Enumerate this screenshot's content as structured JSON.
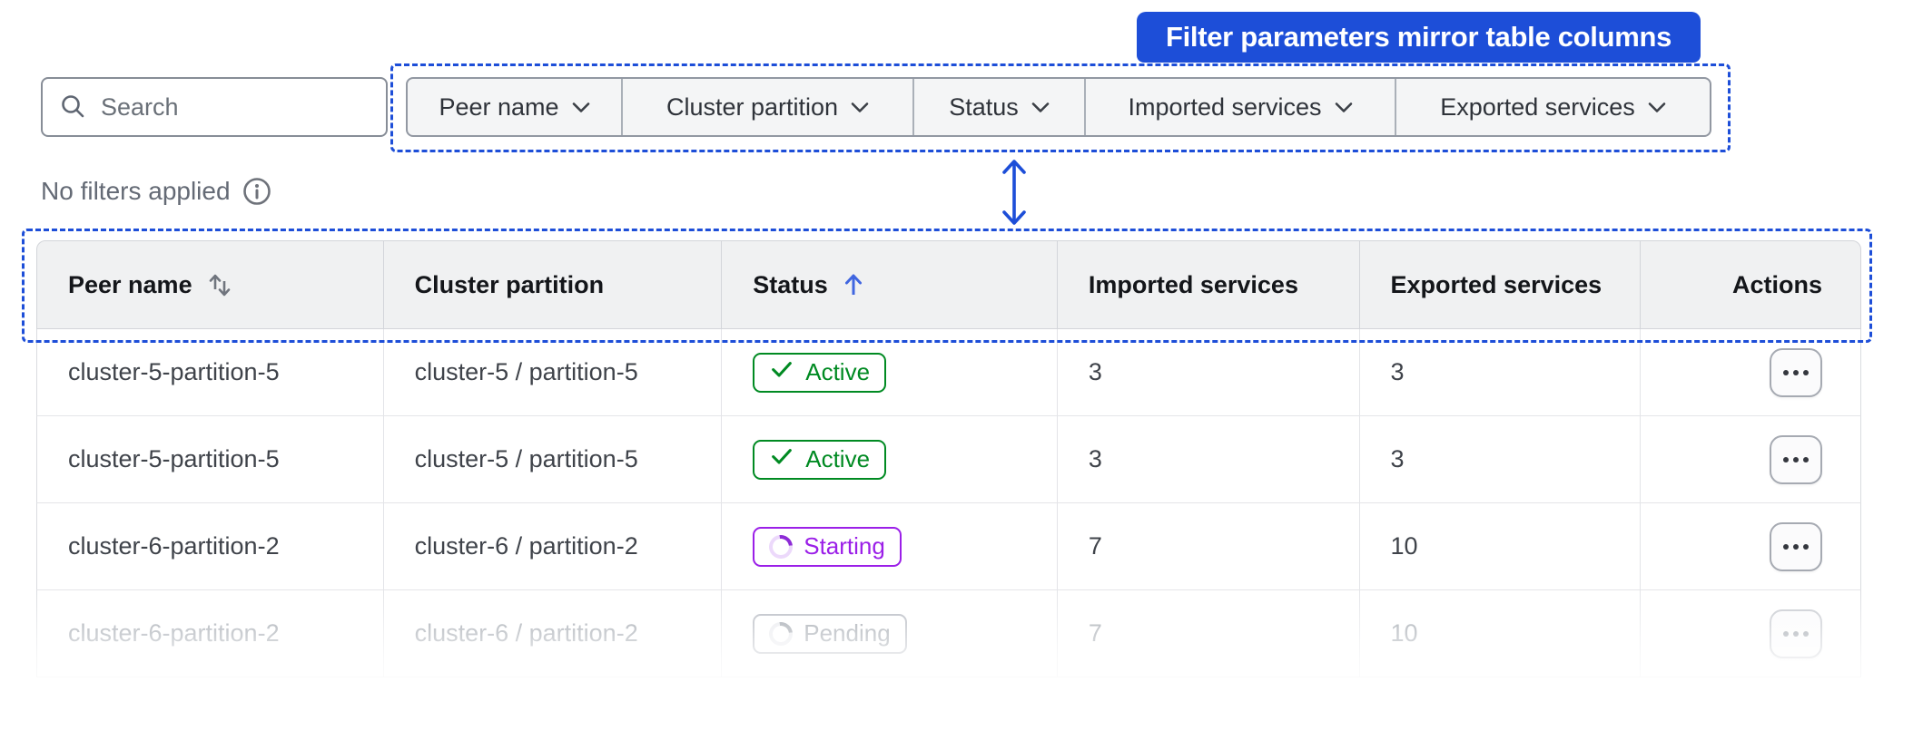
{
  "callout": {
    "label": "Filter parameters mirror table columns",
    "color": "#1d4ed8"
  },
  "annotation": {
    "dashed_color": "#1d4ed8",
    "arrow_color": "#1d4ed8"
  },
  "search": {
    "placeholder": "Search"
  },
  "filters": {
    "items": [
      {
        "label": "Peer name"
      },
      {
        "label": "Cluster partition"
      },
      {
        "label": "Status"
      },
      {
        "label": "Imported services"
      },
      {
        "label": "Exported services"
      }
    ]
  },
  "filter_status": {
    "text": "No filters applied"
  },
  "icons": {
    "search": "magnifier",
    "info": "circle-i",
    "chevron_down": "v",
    "sort_both": "up-down-arrows",
    "sort_asc": "up-arrow",
    "check": "checkmark",
    "spinner": "loading-arc",
    "ellipsis": "three-dots",
    "connector": "vertical-double-arrow"
  },
  "table": {
    "columns": [
      {
        "label": "Peer name",
        "sort": "both"
      },
      {
        "label": "Cluster partition",
        "sort": "none"
      },
      {
        "label": "Status",
        "sort": "asc",
        "sort_color": "#4066e0"
      },
      {
        "label": "Imported services",
        "sort": "none"
      },
      {
        "label": "Exported services",
        "sort": "none"
      },
      {
        "label": "Actions",
        "sort": "none"
      }
    ],
    "rows": [
      {
        "peer_name": "cluster-5-partition-5",
        "cluster_partition": "cluster-5 / partition-5",
        "status": "Active",
        "status_variant": "active",
        "imported": "3",
        "exported": "3",
        "faded": false
      },
      {
        "peer_name": "cluster-5-partition-5",
        "cluster_partition": "cluster-5 / partition-5",
        "status": "Active",
        "status_variant": "active",
        "imported": "3",
        "exported": "3",
        "faded": false
      },
      {
        "peer_name": "cluster-6-partition-2",
        "cluster_partition": "cluster-6 / partition-2",
        "status": "Starting",
        "status_variant": "starting",
        "imported": "7",
        "exported": "10",
        "faded": false
      },
      {
        "peer_name": "cluster-6-partition-2",
        "cluster_partition": "cluster-6 / partition-2",
        "status": "Pending",
        "status_variant": "pending",
        "imported": "7",
        "exported": "10",
        "faded": true
      }
    ],
    "status_colors": {
      "active": "#008a22",
      "starting": "#9b1fe8",
      "pending": "#686d76"
    }
  }
}
